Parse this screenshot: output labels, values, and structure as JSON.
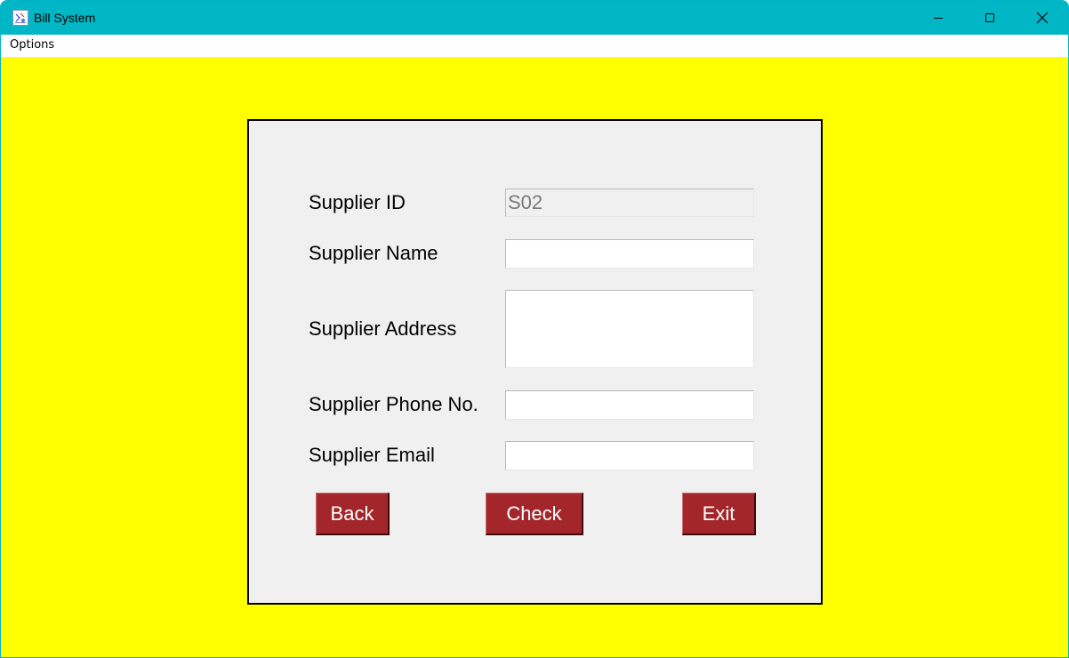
{
  "window": {
    "title": "Bill System",
    "icon": "app-icon",
    "controls": [
      "minimize-icon",
      "maximize-icon",
      "close-icon"
    ]
  },
  "menubar": {
    "items": [
      {
        "label": "Options"
      }
    ]
  },
  "form": {
    "fields": [
      {
        "label": "Supplier ID",
        "value": "S02",
        "readonly": true
      },
      {
        "label": "Supplier Name",
        "value": ""
      },
      {
        "label": "Supplier Address",
        "value": ""
      },
      {
        "label": "Supplier Phone No.",
        "value": ""
      },
      {
        "label": "Supplier Email",
        "value": ""
      }
    ],
    "buttons": {
      "back": "Back",
      "check": "Check",
      "exit": "Exit"
    }
  },
  "colors": {
    "titlebar": "#02b7c5",
    "background": "#ffff00",
    "panel": "#f0f0f0",
    "button": "#a3262a",
    "button_text": "#ffffff"
  }
}
